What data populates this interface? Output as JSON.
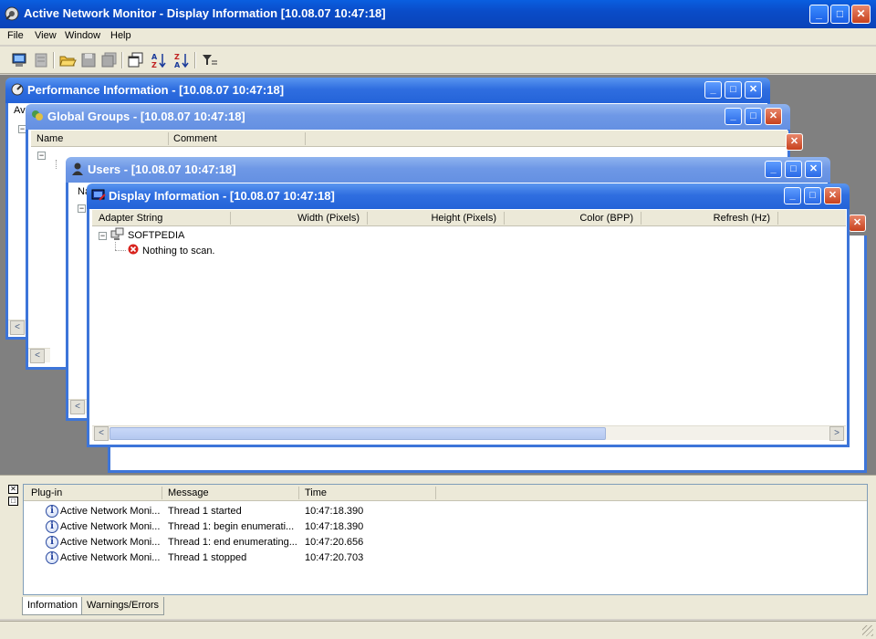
{
  "app": {
    "title": "Active Network Monitor - Display Information [10.08.07 10:47:18]"
  },
  "menu": [
    "File",
    "View",
    "Window",
    "Help"
  ],
  "toolbar": {
    "icons": [
      "computer-icon",
      "server-icon",
      "open-folder-icon",
      "save-icon",
      "save-all-icon",
      "copy-window-icon",
      "sort-ascending-icon",
      "sort-descending-icon",
      "filter-icon"
    ]
  },
  "windows": {
    "performance": {
      "title": "Performance Information - [10.08.07 10:47:18]",
      "partial_col": "Av"
    },
    "groups": {
      "title": "Global Groups - [10.08.07 10:47:18]",
      "columns": [
        "Name",
        "Comment"
      ]
    },
    "users": {
      "title": "Users - [10.08.07 10:47:18]",
      "partial_col": "Na"
    },
    "display": {
      "title": "Display Information - [10.08.07 10:47:18]",
      "columns": [
        "Adapter String",
        "Width (Pixels)",
        "Height (Pixels)",
        "Color (BPP)",
        "Refresh (Hz)"
      ],
      "tree": {
        "root": "SOFTPEDIA",
        "child": "Nothing to scan."
      }
    }
  },
  "log": {
    "columns": [
      "Plug-in",
      "Message",
      "Time"
    ],
    "rows": [
      {
        "plugin": "Active Network Moni...",
        "message": "Thread 1 started",
        "time": "10:47:18.390"
      },
      {
        "plugin": "Active Network Moni...",
        "message": "Thread 1: begin enumerati...",
        "time": "10:47:18.390"
      },
      {
        "plugin": "Active Network Moni...",
        "message": "Thread 1: end enumerating...",
        "time": "10:47:20.656"
      },
      {
        "plugin": "Active Network Moni...",
        "message": "Thread 1 stopped",
        "time": "10:47:20.703"
      }
    ],
    "tabs": [
      "Information",
      "Warnings/Errors"
    ]
  },
  "colors": {
    "title_active": "#0a4cc8",
    "child_title": "#2f6ee0",
    "close_red": "#c8421e"
  }
}
